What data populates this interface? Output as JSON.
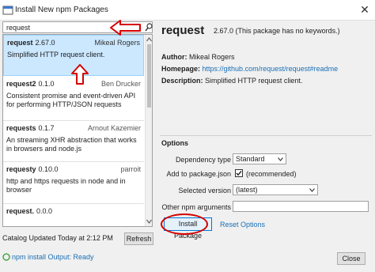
{
  "window": {
    "title": "Install New npm Packages",
    "close_glyph": "✕"
  },
  "search": {
    "value": "request",
    "placeholder": ""
  },
  "results": [
    {
      "name": "request",
      "version": "2.67.0",
      "author": "Mikeal Rogers",
      "description": "Simplified HTTP request client.",
      "selected": true
    },
    {
      "name": "request2",
      "version": "0.1.0",
      "author": "Ben Drucker",
      "description": "Consistent promise and event-driven API for performing HTTP/JSON requests"
    },
    {
      "name": "requests",
      "version": "0.1.7",
      "author": "Arnout Kazemier",
      "description": "An streaming XHR abstraction that works in browsers and node.js"
    },
    {
      "name": "requesty",
      "version": "0.10.0",
      "author": "parroit",
      "description": "http and https requests in node and in browser"
    },
    {
      "name": "request.",
      "version": "0.0.0",
      "author": "",
      "description": ""
    }
  ],
  "catalog": {
    "status": "Catalog Updated Today at 2:12 PM",
    "refresh_label": "Refresh"
  },
  "status_bar": {
    "text": "npm install Output: Ready"
  },
  "details": {
    "name": "request",
    "version": "2.67.0",
    "keywords": "(This package has no keywords.)",
    "author_label": "Author:",
    "author": "Mikeal Rogers",
    "homepage_label": "Homepage:",
    "homepage": "https://github.com/request/request#readme",
    "description_label": "Description:",
    "description": "Simplified HTTP request client."
  },
  "options": {
    "title": "Options",
    "dependency_type_label": "Dependency type",
    "dependency_type_value": "Standard",
    "add_to_package_label": "Add to package.json",
    "add_to_package_checked": true,
    "add_to_package_text": "(recommended)",
    "selected_version_label": "Selected version",
    "selected_version_value": "(latest)",
    "other_args_label": "Other npm arguments",
    "other_args_value": ""
  },
  "actions": {
    "install_label": "Install Package",
    "reset_label": "Reset Options",
    "close_label": "Close"
  },
  "colors": {
    "selection": "#cce8ff",
    "link": "#1a6fb5",
    "annotation_red": "#d40000"
  }
}
